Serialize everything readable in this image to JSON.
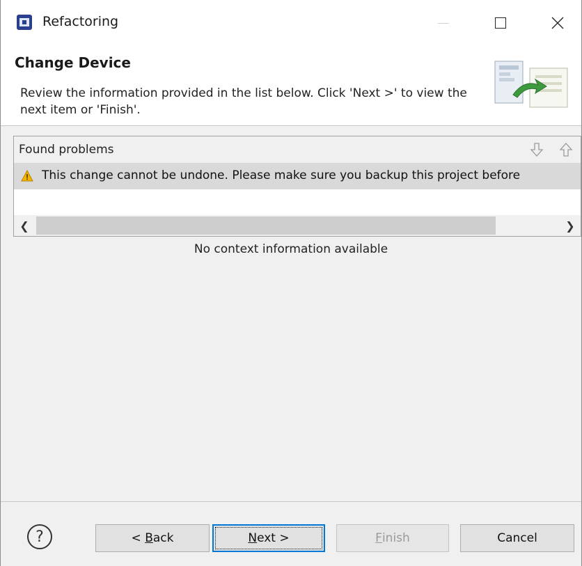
{
  "window": {
    "title": "Refactoring"
  },
  "header": {
    "title": "Change Device",
    "description": "Review the information provided in the list below. Click 'Next >' to view the next item or 'Finish'."
  },
  "problems": {
    "title": "Found problems",
    "items": [
      {
        "severity": "warning",
        "text": "This change cannot be undone. Please make sure you backup this project before"
      }
    ]
  },
  "context": {
    "message": "No context information available"
  },
  "buttons": {
    "help": "?",
    "back_prefix": "< ",
    "back_mnemonic": "B",
    "back_rest": "ack",
    "next_mnemonic": "N",
    "next_rest": "ext >",
    "finish_mnemonic": "F",
    "finish_rest": "inish",
    "cancel": "Cancel"
  },
  "colors": {
    "accent": "#0078d7",
    "warning": "#f5b400",
    "selected_row": "#d9d9d9"
  }
}
